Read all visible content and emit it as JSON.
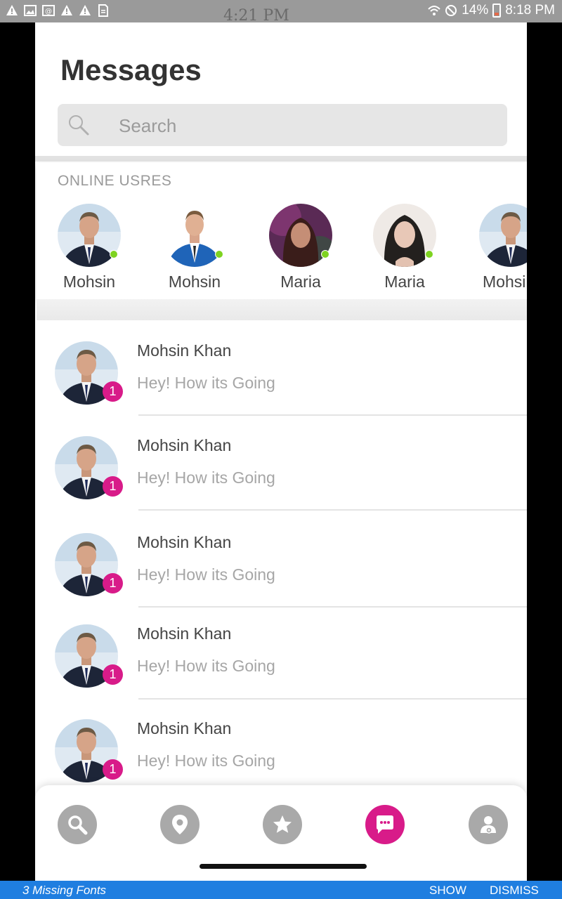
{
  "status_bar": {
    "ghost_time": "4:21 PM",
    "battery_percent": "14%",
    "time": "8:18 PM"
  },
  "page_title": "Messages",
  "search": {
    "placeholder": "Search"
  },
  "online_section": {
    "label": "ONLINE USRES",
    "users": [
      {
        "name": "Mohsin",
        "online": true
      },
      {
        "name": "Mohsin",
        "online": true
      },
      {
        "name": "Maria",
        "online": true
      },
      {
        "name": "Maria",
        "online": true
      },
      {
        "name": "Mohsin",
        "online": false
      }
    ]
  },
  "conversations": [
    {
      "name": "Mohsin Khan",
      "message": "Hey! How its Going",
      "unread": "1"
    },
    {
      "name": "Mohsin Khan",
      "message": "Hey! How its Going",
      "unread": "1"
    },
    {
      "name": "Mohsin Khan",
      "message": "Hey! How its Going",
      "unread": "1"
    },
    {
      "name": "Mohsin Khan",
      "message": "Hey! How its Going",
      "unread": "1"
    },
    {
      "name": "Mohsin Khan",
      "message": "Hey! How its Going",
      "unread": "1"
    }
  ],
  "bottom_nav": [
    {
      "icon": "search-icon",
      "active": false
    },
    {
      "icon": "location-pin-icon",
      "active": false
    },
    {
      "icon": "star-icon",
      "active": false
    },
    {
      "icon": "chat-icon",
      "active": true
    },
    {
      "icon": "profile-icon",
      "active": false
    }
  ],
  "colors": {
    "accent": "#d81b89",
    "online_dot": "#7ed321",
    "snackbar": "#1f7ee0"
  },
  "snackbar": {
    "message": "3 Missing Fonts",
    "show_label": "SHOW",
    "dismiss_label": "DISMISS"
  }
}
